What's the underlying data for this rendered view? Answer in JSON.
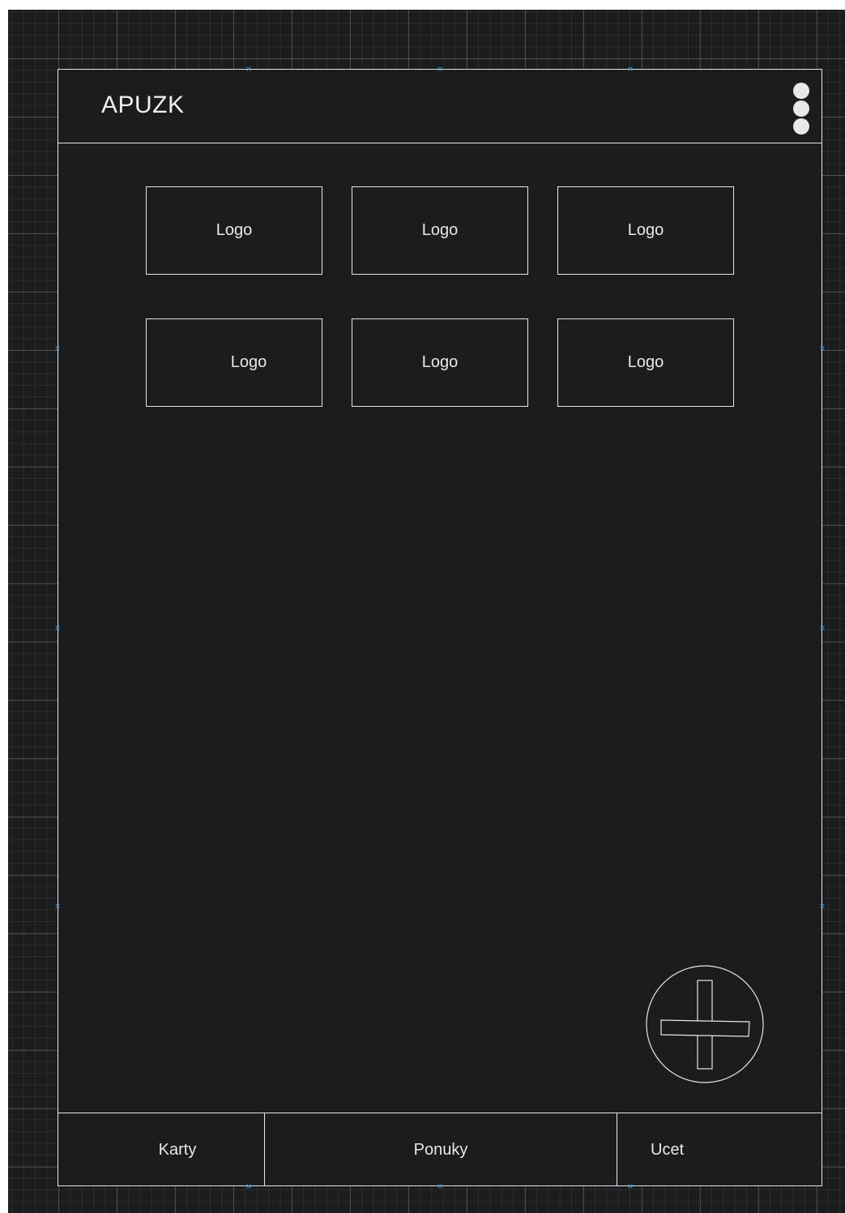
{
  "app_bar": {
    "title": "APUZK",
    "menu_icon": "kebab-menu-icon"
  },
  "logo_grid": {
    "items": [
      {
        "label": "Logo"
      },
      {
        "label": "Logo"
      },
      {
        "label": "Logo"
      },
      {
        "label": "Logo"
      },
      {
        "label": "Logo"
      },
      {
        "label": "Logo"
      }
    ]
  },
  "fab": {
    "icon": "plus-icon"
  },
  "bottom_nav": {
    "items": [
      {
        "label": "Karty"
      },
      {
        "label": "Ponuky"
      },
      {
        "label": "Ucet"
      }
    ]
  },
  "colors": {
    "background": "#1b1c1e",
    "stroke": "#e6e6e6",
    "text": "#e8e8e8",
    "handle_marker": "#3aa0e6"
  }
}
